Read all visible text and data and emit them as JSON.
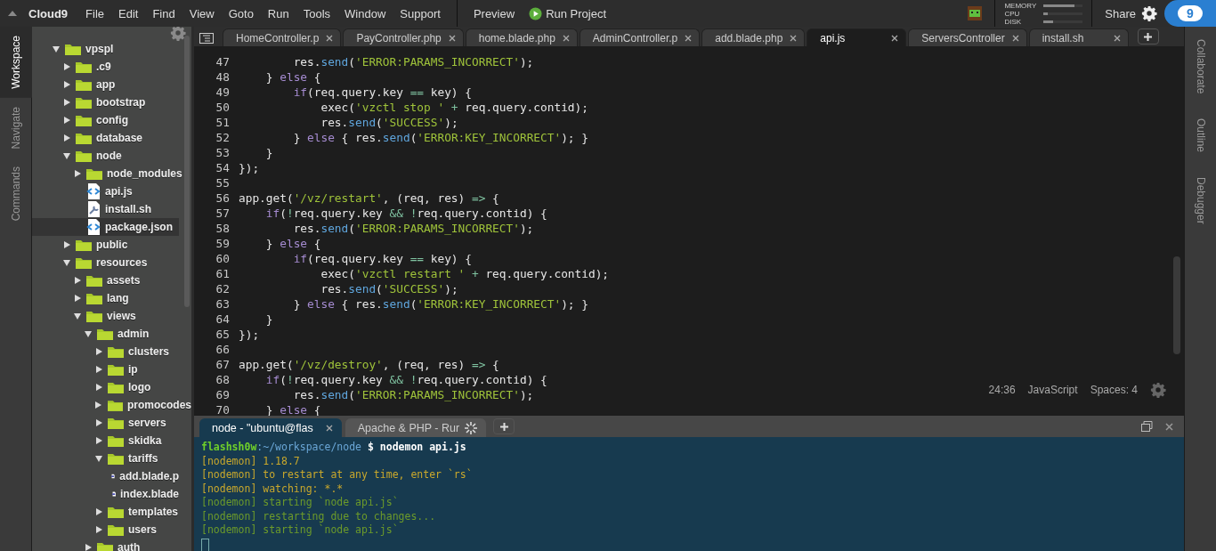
{
  "menubar": {
    "brand": "Cloud9",
    "items": [
      "File",
      "Edit",
      "Find",
      "View",
      "Goto",
      "Run",
      "Tools",
      "Window",
      "Support"
    ],
    "preview": "Preview",
    "run": "Run Project",
    "meters": [
      {
        "label": "MEMORY",
        "level": 0.8
      },
      {
        "label": "CPU",
        "level": 0.1
      },
      {
        "label": "DISK",
        "level": 0.25
      }
    ],
    "share": "Share",
    "logo": "9"
  },
  "left_tabs": [
    {
      "label": "Workspace",
      "selected": true
    },
    {
      "label": "Navigate",
      "selected": false
    },
    {
      "label": "Commands",
      "selected": false
    }
  ],
  "right_tabs": [
    {
      "label": "Collaborate"
    },
    {
      "label": "Outline"
    },
    {
      "label": "Debugger"
    }
  ],
  "tree": [
    {
      "name": "vpspl",
      "kind": "folder",
      "expanded": true,
      "children": [
        {
          "name": ".c9",
          "kind": "folder",
          "expanded": false
        },
        {
          "name": "app",
          "kind": "folder",
          "expanded": false
        },
        {
          "name": "bootstrap",
          "kind": "folder",
          "expanded": false
        },
        {
          "name": "config",
          "kind": "folder",
          "expanded": false
        },
        {
          "name": "database",
          "kind": "folder",
          "expanded": false
        },
        {
          "name": "node",
          "kind": "folder",
          "expanded": true,
          "children": [
            {
              "name": "node_modules",
              "kind": "folder",
              "expanded": false
            },
            {
              "name": "api.js",
              "kind": "js",
              "selected": false
            },
            {
              "name": "install.sh",
              "kind": "sh",
              "selected": false
            },
            {
              "name": "package.json",
              "kind": "js",
              "selected": true
            }
          ]
        },
        {
          "name": "public",
          "kind": "folder",
          "expanded": false
        },
        {
          "name": "resources",
          "kind": "folder",
          "expanded": true,
          "children": [
            {
              "name": "assets",
              "kind": "folder",
              "expanded": false
            },
            {
              "name": "lang",
              "kind": "folder",
              "expanded": false
            },
            {
              "name": "views",
              "kind": "folder",
              "expanded": true,
              "children": [
                {
                  "name": "admin",
                  "kind": "folder",
                  "expanded": true,
                  "children": [
                    {
                      "name": "clusters",
                      "kind": "folder",
                      "expanded": false
                    },
                    {
                      "name": "ip",
                      "kind": "folder",
                      "expanded": false
                    },
                    {
                      "name": "logo",
                      "kind": "folder",
                      "expanded": false
                    },
                    {
                      "name": "promocodes",
                      "kind": "folder",
                      "expanded": false
                    },
                    {
                      "name": "servers",
                      "kind": "folder",
                      "expanded": false
                    },
                    {
                      "name": "skidka",
                      "kind": "folder",
                      "expanded": false
                    },
                    {
                      "name": "tariffs",
                      "kind": "folder",
                      "expanded": true,
                      "children": [
                        {
                          "name": "add.blade.p",
                          "kind": "php",
                          "selected": false
                        },
                        {
                          "name": "index.blade",
                          "kind": "php",
                          "selected": false
                        }
                      ]
                    },
                    {
                      "name": "templates",
                      "kind": "folder",
                      "expanded": false
                    },
                    {
                      "name": "users",
                      "kind": "folder",
                      "expanded": false
                    }
                  ]
                },
                {
                  "name": "auth",
                  "kind": "folder",
                  "expanded": false
                }
              ]
            }
          ]
        }
      ]
    }
  ],
  "editor_tabs": [
    {
      "label": "HomeController.p",
      "selected": false
    },
    {
      "label": "PayController.php",
      "selected": false
    },
    {
      "label": "home.blade.php",
      "selected": false
    },
    {
      "label": "AdminController.p",
      "selected": false
    },
    {
      "label": "add.blade.php",
      "selected": false
    },
    {
      "label": "api.js",
      "selected": true
    },
    {
      "label": "ServersController",
      "selected": false
    },
    {
      "label": "install.sh",
      "selected": false
    }
  ],
  "code": [
    {
      "n": "47",
      "tokens": [
        {
          "kind": "p",
          "text": "        res."
        },
        {
          "kind": "fn",
          "text": "send"
        },
        {
          "kind": "p",
          "text": "("
        },
        {
          "kind": "s",
          "text": "'ERROR:PARAMS_INCORRECT'"
        },
        {
          "kind": "p",
          "text": ");"
        }
      ]
    },
    {
      "n": "48",
      "tokens": [
        {
          "kind": "p",
          "text": "    } "
        },
        {
          "kind": "kw",
          "text": "else"
        },
        {
          "kind": "p",
          "text": " {"
        }
      ]
    },
    {
      "n": "49",
      "tokens": [
        {
          "kind": "kw",
          "text": "        if"
        },
        {
          "kind": "p",
          "text": "(req.query.key "
        },
        {
          "kind": "op",
          "text": "=="
        },
        {
          "kind": "p",
          "text": " key) {"
        }
      ]
    },
    {
      "n": "50",
      "tokens": [
        {
          "kind": "p",
          "text": "            exec("
        },
        {
          "kind": "s",
          "text": "'vzctl stop '"
        },
        {
          "kind": "op",
          "text": " +"
        },
        {
          "kind": "p",
          "text": " req.query.contid);"
        }
      ]
    },
    {
      "n": "51",
      "tokens": [
        {
          "kind": "p",
          "text": "            res."
        },
        {
          "kind": "fn",
          "text": "send"
        },
        {
          "kind": "p",
          "text": "("
        },
        {
          "kind": "s",
          "text": "'SUCCESS'"
        },
        {
          "kind": "p",
          "text": ");"
        }
      ]
    },
    {
      "n": "52",
      "tokens": [
        {
          "kind": "p",
          "text": "        } "
        },
        {
          "kind": "kw",
          "text": "else"
        },
        {
          "kind": "p",
          "text": " { res."
        },
        {
          "kind": "fn",
          "text": "send"
        },
        {
          "kind": "p",
          "text": "("
        },
        {
          "kind": "s",
          "text": "'ERROR:KEY_INCORRECT'"
        },
        {
          "kind": "p",
          "text": "); }"
        }
      ]
    },
    {
      "n": "53",
      "tokens": [
        {
          "kind": "p",
          "text": "    }"
        }
      ]
    },
    {
      "n": "54",
      "tokens": [
        {
          "kind": "p",
          "text": "});"
        }
      ]
    },
    {
      "n": "55"
    },
    {
      "n": "56",
      "tokens": [
        {
          "kind": "p",
          "text": "app.get("
        },
        {
          "kind": "s",
          "text": "'/vz/restart'"
        },
        {
          "kind": "p",
          "text": ", (req, res) "
        },
        {
          "kind": "op",
          "text": "=>"
        },
        {
          "kind": "p",
          "text": " {"
        }
      ]
    },
    {
      "n": "57",
      "tokens": [
        {
          "kind": "kw",
          "text": "    if"
        },
        {
          "kind": "p",
          "text": "("
        },
        {
          "kind": "op",
          "text": "!"
        },
        {
          "kind": "p",
          "text": "req.query.key "
        },
        {
          "kind": "op",
          "text": "&&"
        },
        {
          "kind": "op",
          "text": " !"
        },
        {
          "kind": "p",
          "text": "req.query.contid) {"
        }
      ]
    },
    {
      "n": "58",
      "tokens": [
        {
          "kind": "p",
          "text": "        res."
        },
        {
          "kind": "fn",
          "text": "send"
        },
        {
          "kind": "p",
          "text": "("
        },
        {
          "kind": "s",
          "text": "'ERROR:PARAMS_INCORRECT'"
        },
        {
          "kind": "p",
          "text": ");"
        }
      ]
    },
    {
      "n": "59",
      "tokens": [
        {
          "kind": "p",
          "text": "    } "
        },
        {
          "kind": "kw",
          "text": "else"
        },
        {
          "kind": "p",
          "text": " {"
        }
      ]
    },
    {
      "n": "60",
      "tokens": [
        {
          "kind": "kw",
          "text": "        if"
        },
        {
          "kind": "p",
          "text": "(req.query.key "
        },
        {
          "kind": "op",
          "text": "=="
        },
        {
          "kind": "p",
          "text": " key) {"
        }
      ]
    },
    {
      "n": "61",
      "tokens": [
        {
          "kind": "p",
          "text": "            exec("
        },
        {
          "kind": "s",
          "text": "'vzctl restart '"
        },
        {
          "kind": "op",
          "text": " +"
        },
        {
          "kind": "p",
          "text": " req.query.contid);"
        }
      ]
    },
    {
      "n": "62",
      "tokens": [
        {
          "kind": "p",
          "text": "            res."
        },
        {
          "kind": "fn",
          "text": "send"
        },
        {
          "kind": "p",
          "text": "("
        },
        {
          "kind": "s",
          "text": "'SUCCESS'"
        },
        {
          "kind": "p",
          "text": ");"
        }
      ]
    },
    {
      "n": "63",
      "tokens": [
        {
          "kind": "p",
          "text": "        } "
        },
        {
          "kind": "kw",
          "text": "else"
        },
        {
          "kind": "p",
          "text": " { res."
        },
        {
          "kind": "fn",
          "text": "send"
        },
        {
          "kind": "p",
          "text": "("
        },
        {
          "kind": "s",
          "text": "'ERROR:KEY_INCORRECT'"
        },
        {
          "kind": "p",
          "text": "); }"
        }
      ]
    },
    {
      "n": "64",
      "tokens": [
        {
          "kind": "p",
          "text": "    }"
        }
      ]
    },
    {
      "n": "65",
      "tokens": [
        {
          "kind": "p",
          "text": "});"
        }
      ]
    },
    {
      "n": "66"
    },
    {
      "n": "67",
      "tokens": [
        {
          "kind": "p",
          "text": "app.get("
        },
        {
          "kind": "s",
          "text": "'/vz/destroy'"
        },
        {
          "kind": "p",
          "text": ", (req, res) "
        },
        {
          "kind": "op",
          "text": "=>"
        },
        {
          "kind": "p",
          "text": " {"
        }
      ]
    },
    {
      "n": "68",
      "tokens": [
        {
          "kind": "kw",
          "text": "    if"
        },
        {
          "kind": "p",
          "text": "("
        },
        {
          "kind": "op",
          "text": "!"
        },
        {
          "kind": "p",
          "text": "req.query.key "
        },
        {
          "kind": "op",
          "text": "&&"
        },
        {
          "kind": "op",
          "text": " !"
        },
        {
          "kind": "p",
          "text": "req.query.contid) {"
        }
      ]
    },
    {
      "n": "69",
      "tokens": [
        {
          "kind": "p",
          "text": "        res."
        },
        {
          "kind": "fn",
          "text": "send"
        },
        {
          "kind": "p",
          "text": "("
        },
        {
          "kind": "s",
          "text": "'ERROR:PARAMS_INCORRECT'"
        },
        {
          "kind": "p",
          "text": ");"
        }
      ]
    },
    {
      "n": "70",
      "tokens": [
        {
          "kind": "p",
          "text": "    } "
        },
        {
          "kind": "kw",
          "text": "else"
        },
        {
          "kind": "p",
          "text": " {"
        }
      ]
    }
  ],
  "status": {
    "position": "24:36",
    "language": "JavaScript",
    "indent": "Spaces: 4"
  },
  "terminal_tabs": [
    {
      "label": "node - \"ubuntu@flas",
      "selected": true,
      "kind": "closable"
    },
    {
      "label": "Apache & PHP - Rur",
      "selected": false,
      "kind": "busy"
    }
  ],
  "terminal": [
    {
      "kind": "prompt",
      "user": "flashsh0w",
      "path": ":~/workspace/node",
      "command": "$ nodemon api.js"
    },
    {
      "kind": "info",
      "text": "[nodemon] 1.18.7"
    },
    {
      "kind": "info",
      "text": "[nodemon] to restart at any time, enter `rs`"
    },
    {
      "kind": "info",
      "text": "[nodemon] watching: *.*"
    },
    {
      "kind": "start",
      "text": "[nodemon] starting `node api.js`"
    },
    {
      "kind": "start",
      "text": "[nodemon] restarting due to changes..."
    },
    {
      "kind": "start",
      "text": "[nodemon] starting `node api.js`"
    }
  ]
}
